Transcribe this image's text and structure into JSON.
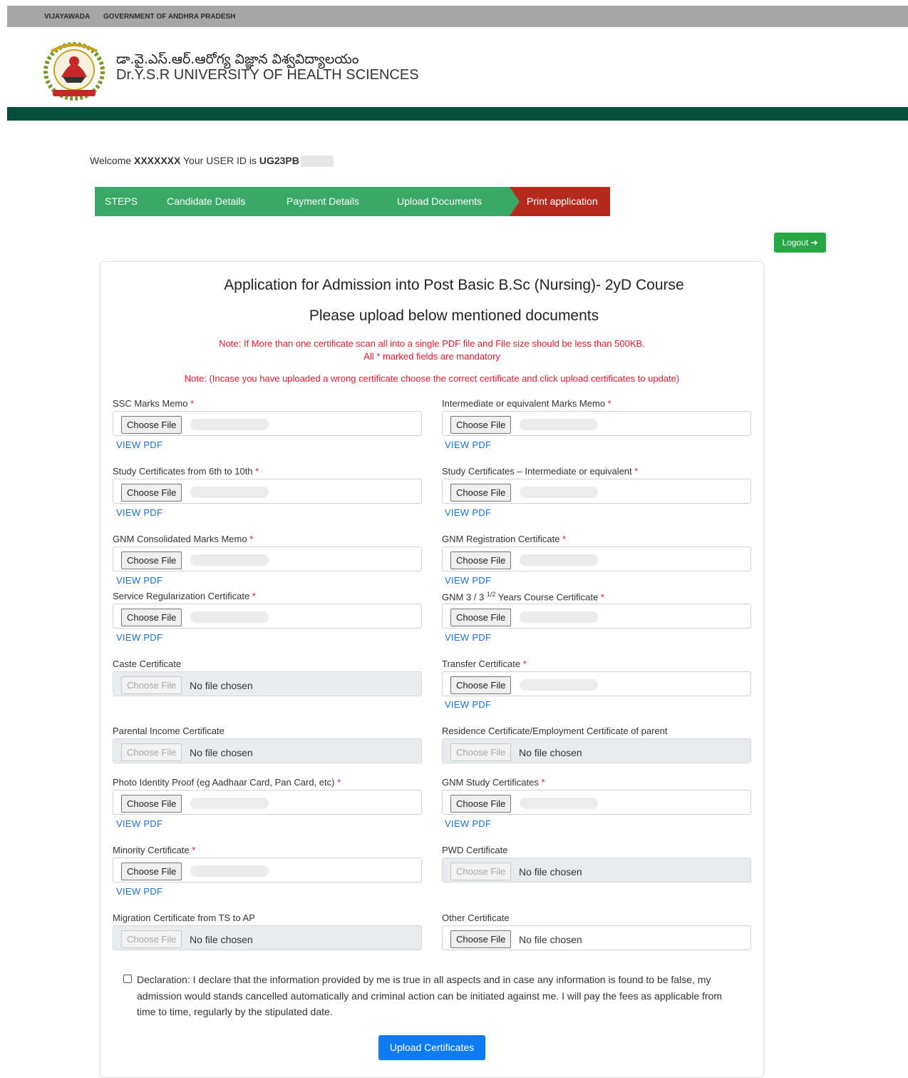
{
  "topbar": {
    "left": "VIJAYAWADA",
    "right": "GOVERNMENT OF ANDHRA PRADESH"
  },
  "header": {
    "title_te": "డా.వై.ఎస్.ఆర్.ఆరోగ్య విజ్ఞాన విశ్వవిద్యాలయం",
    "title_en": "Dr.Y.S.R UNIVERSITY OF HEALTH SCIENCES"
  },
  "welcome": {
    "prefix": "Welcome ",
    "name": "XXXXXXX",
    "middle": " Your USER ID is ",
    "user_id": "UG23PB"
  },
  "steps": [
    "STEPS",
    "Candidate Details",
    "Payment Details",
    "Upload Documents",
    "Print application"
  ],
  "logout_label": "Logout",
  "form": {
    "title": "Application for Admission into Post Basic B.Sc (Nursing)- 2yD Course",
    "subtitle": "Please upload below mentioned documents",
    "note1": "Note: If More than one certificate scan all into a single PDF file and File size should be less than 500KB.",
    "note1b": "All * marked fields are mandatory",
    "note2": "Note: (Incase you have uploaded a wrong certificate choose the correct certificate and click upload certificates to update)",
    "choose_label": "Choose File",
    "no_file": "No file chosen",
    "view_pdf": "VIEW PDF",
    "fields": {
      "ssc": "SSC Marks Memo",
      "inter": "Intermediate or equivalent Marks Memo",
      "study610": "Study Certificates from 6th to 10th",
      "study_inter": "Study Certificates – Intermediate or equivalent",
      "gnm_marks": "GNM Consolidated Marks Memo",
      "gnm_reg": "GNM Registration Certificate",
      "service": "Service Regularization Certificate",
      "gnm_course_a": "GNM 3 / 3 ",
      "gnm_course_sup": "1/2",
      "gnm_course_b": " Years Course Certificate",
      "caste": "Caste Certificate",
      "transfer": "Transfer Certificate",
      "income": "Parental Income Certificate",
      "residence": "Residence Certificate/Employment Certificate of parent",
      "photo_id": "Photo Identity Proof (eg Aadhaar Card, Pan Card, etc)",
      "gnm_study": "GNM Study Certificates",
      "minority": "Minority Certificate",
      "pwd": "PWD Certificate",
      "migration": "Migration Certificate from TS to AP",
      "other": "Other Certificate"
    },
    "declaration": "Declaration: I declare that the information provided by me is true in all aspects and in case any information is found to be false, my admission would stands cancelled automatically and criminal action can be initiated against me. I will pay the fees as applicable from time to time, regularly by the stipulated date.",
    "upload_label": "Upload Certificates"
  },
  "colors": {
    "green_step": "#3aa968",
    "red_step": "#b52a1d",
    "dark_green": "#064d3c",
    "note_red": "#e8192c",
    "link_blue": "#1a6fd1",
    "primary": "#0d7bf2"
  }
}
